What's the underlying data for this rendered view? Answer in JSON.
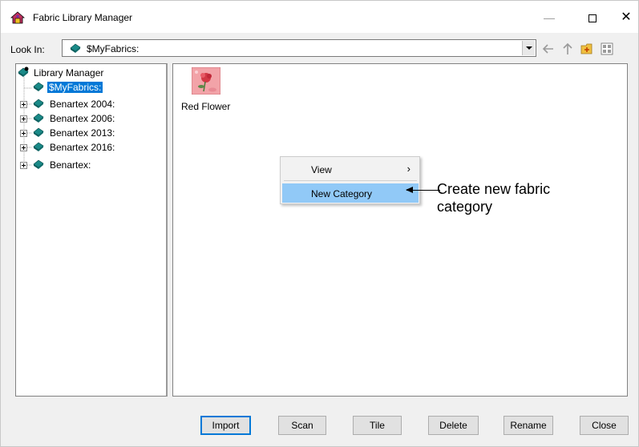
{
  "window": {
    "title": "Fabric Library Manager",
    "icon": "house-icon",
    "controls": {
      "minimize": "—",
      "close": "✕"
    }
  },
  "toolbar": {
    "look_in_label": "Look In:",
    "look_in_value": "$MyFabrics:",
    "icons": [
      "back-arrow-icon",
      "up-arrow-icon",
      "new-folder-icon",
      "view-menu-icon"
    ]
  },
  "tree": {
    "root": "Library Manager",
    "items": [
      {
        "label": "$MyFabrics:",
        "selected": true
      },
      {
        "label": "Benartex 2004:"
      },
      {
        "label": "Benartex 2006:"
      },
      {
        "label": "Benartex 2013:"
      },
      {
        "label": "Benartex 2016:"
      },
      {
        "label": "Benartex:"
      }
    ]
  },
  "content": {
    "items": [
      {
        "label": "Red Flower"
      }
    ]
  },
  "context_menu": {
    "items": [
      {
        "label": "View",
        "submenu_glyph": "›"
      },
      {
        "label": "New Category",
        "highlighted": true
      }
    ]
  },
  "annotation": {
    "text": "Create new fabric category"
  },
  "buttons": {
    "import": "Import",
    "scan": "Scan",
    "tile": "Tile",
    "delete": "Delete",
    "rename": "Rename",
    "close": "Close"
  },
  "colors": {
    "selection": "#0078d7",
    "menu_highlight": "#91c9f7",
    "book_icon": "#1a8a88"
  }
}
